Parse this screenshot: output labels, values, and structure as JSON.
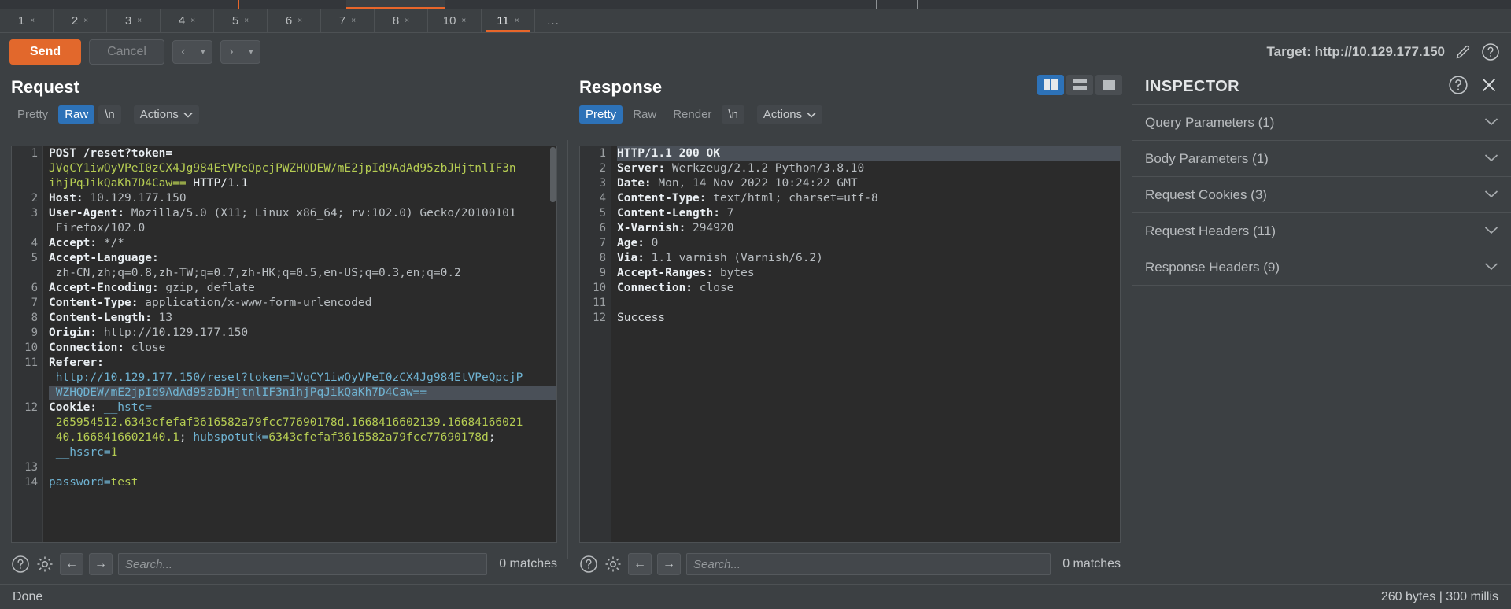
{
  "window": {
    "tabs": [
      {
        "label": "1",
        "close": "×",
        "active": false
      },
      {
        "label": "2",
        "close": "×",
        "active": false
      },
      {
        "label": "3",
        "close": "×",
        "active": false
      },
      {
        "label": "4",
        "close": "×",
        "active": false
      },
      {
        "label": "5",
        "close": "×",
        "active": false
      },
      {
        "label": "6",
        "close": "×",
        "active": false
      },
      {
        "label": "7",
        "close": "×",
        "active": false
      },
      {
        "label": "8",
        "close": "×",
        "active": false
      },
      {
        "label": "10",
        "close": "×",
        "active": false
      },
      {
        "label": "11",
        "close": "×",
        "active": true
      }
    ],
    "more_tabs_label": "..."
  },
  "actionbar": {
    "send_label": "Send",
    "cancel_label": "Cancel",
    "prev_icon": "‹",
    "prev_caret": "▾",
    "next_icon": "›",
    "next_caret": "▾",
    "target_label": "Target: http://10.129.177.150",
    "edit_icon": "pencil-icon",
    "help_icon": "help-circle-icon"
  },
  "request": {
    "title": "Request",
    "modes": [
      {
        "label": "Pretty",
        "style": "dim"
      },
      {
        "label": "Raw",
        "style": "selected"
      },
      {
        "label": "\\n",
        "style": "plain"
      },
      {
        "label": "Actions",
        "style": "group",
        "caret": "⌄"
      }
    ],
    "line_numbers": [
      "1",
      "",
      "",
      "2",
      "3",
      "",
      "4",
      "5",
      "",
      "6",
      "7",
      "8",
      "9",
      "10",
      "11",
      "",
      "",
      "12",
      "",
      "",
      "",
      "13",
      "14"
    ],
    "lines": [
      {
        "n": "1",
        "segments": [
          {
            "t": "POST /reset?token=",
            "c": "hdr"
          }
        ]
      },
      {
        "n": "",
        "segments": [
          {
            "t": "JVqCY1iwOyVPeI0zCX4Jg984EtVPeQpcjPWZHQDEW/mE2jpId9AdAd95zbJHjtnlIF3n",
            "c": "green"
          }
        ]
      },
      {
        "n": "",
        "segments": [
          {
            "t": "ihjPqJikQaKh7D4Caw==",
            "c": "green"
          },
          {
            "t": " HTTP/1.1",
            "c": "white"
          }
        ]
      },
      {
        "n": "2",
        "segments": [
          {
            "t": "Host:",
            "c": "hdr"
          },
          {
            "t": " 10.129.177.150",
            "c": "val"
          }
        ]
      },
      {
        "n": "3",
        "segments": [
          {
            "t": "User-Agent:",
            "c": "hdr"
          },
          {
            "t": " Mozilla/5.0 (X11; Linux x86_64; rv:102.0) Gecko/20100101",
            "c": "val"
          }
        ]
      },
      {
        "n": "",
        "segments": [
          {
            "t": " Firefox/102.0",
            "c": "val"
          }
        ]
      },
      {
        "n": "4",
        "segments": [
          {
            "t": "Accept:",
            "c": "hdr"
          },
          {
            "t": " */*",
            "c": "val"
          }
        ]
      },
      {
        "n": "5",
        "segments": [
          {
            "t": "Accept-Language:",
            "c": "hdr"
          }
        ]
      },
      {
        "n": "",
        "segments": [
          {
            "t": " zh-CN,zh;q=0.8,zh-TW;q=0.7,zh-HK;q=0.5,en-US;q=0.3,en;q=0.2",
            "c": "val"
          }
        ]
      },
      {
        "n": "6",
        "segments": [
          {
            "t": "Accept-Encoding:",
            "c": "hdr"
          },
          {
            "t": " gzip, deflate",
            "c": "val"
          }
        ]
      },
      {
        "n": "7",
        "segments": [
          {
            "t": "Content-Type:",
            "c": "hdr"
          },
          {
            "t": " application/x-www-form-urlencoded",
            "c": "val"
          }
        ]
      },
      {
        "n": "8",
        "segments": [
          {
            "t": "Content-Length:",
            "c": "hdr"
          },
          {
            "t": " 13",
            "c": "val"
          }
        ]
      },
      {
        "n": "9",
        "segments": [
          {
            "t": "Origin:",
            "c": "hdr"
          },
          {
            "t": " http://10.129.177.150",
            "c": "val"
          }
        ]
      },
      {
        "n": "10",
        "segments": [
          {
            "t": "Connection:",
            "c": "hdr"
          },
          {
            "t": " close",
            "c": "val"
          }
        ]
      },
      {
        "n": "11",
        "segments": [
          {
            "t": "Referer:",
            "c": "hdr"
          }
        ]
      },
      {
        "n": "",
        "segments": [
          {
            "t": " http://10.129.177.150/reset?token=JVqCY1iwOyVPeI0zCX4Jg984EtVPeQpcjP",
            "c": "blue"
          }
        ]
      },
      {
        "n": "",
        "selected": true,
        "segments": [
          {
            "t": " WZHQDEW/mE2jpId9AdAd95zbJHjtnlIF3nihjPqJikQaKh7D4Caw==",
            "c": "blue"
          }
        ]
      },
      {
        "n": "12",
        "segments": [
          {
            "t": "Cookie:",
            "c": "hdr"
          },
          {
            "t": " ",
            "c": "val"
          },
          {
            "t": "__hstc=",
            "c": "blue"
          }
        ]
      },
      {
        "n": "",
        "segments": [
          {
            "t": " 265954512.6343cfefaf3616582a79fcc77690178d.1668416602139.16684166021",
            "c": "green"
          }
        ]
      },
      {
        "n": "",
        "segments": [
          {
            "t": " 40.1668416602140.1",
            "c": "green"
          },
          {
            "t": "; ",
            "c": "plain"
          },
          {
            "t": "hubspotutk=",
            "c": "blue"
          },
          {
            "t": "6343cfefaf3616582a79fcc77690178d",
            "c": "green"
          },
          {
            "t": ";",
            "c": "plain"
          }
        ]
      },
      {
        "n": "",
        "segments": [
          {
            "t": " __hssrc=",
            "c": "blue"
          },
          {
            "t": "1",
            "c": "green"
          }
        ]
      },
      {
        "n": "13",
        "segments": []
      },
      {
        "n": "14",
        "segments": [
          {
            "t": "password=",
            "c": "blue"
          },
          {
            "t": "test",
            "c": "green"
          }
        ]
      }
    ],
    "search": {
      "placeholder": "Search...",
      "value": "",
      "matches": "0 matches",
      "help_icon": "help-circle-icon",
      "settings_icon": "gear-icon",
      "back_icon": "←",
      "forward_icon": "→"
    }
  },
  "response": {
    "title": "Response",
    "modes": [
      {
        "label": "Pretty",
        "style": "selected"
      },
      {
        "label": "Raw",
        "style": "dim"
      },
      {
        "label": "Render",
        "style": "dim"
      },
      {
        "label": "\\n",
        "style": "plain"
      },
      {
        "label": "Actions",
        "style": "group",
        "caret": "⌄"
      }
    ],
    "layout_buttons": [
      {
        "name": "split-vertical-layout",
        "active": true
      },
      {
        "name": "split-horizontal-layout",
        "active": false
      },
      {
        "name": "single-pane-layout",
        "active": false
      }
    ],
    "lines": [
      {
        "n": "1",
        "selected": true,
        "segments": [
          {
            "t": "HTTP/1.1 200 OK",
            "c": "hdr"
          }
        ]
      },
      {
        "n": "2",
        "segments": [
          {
            "t": "Server:",
            "c": "hdr"
          },
          {
            "t": " Werkzeug/2.1.2 Python/3.8.10",
            "c": "val"
          }
        ]
      },
      {
        "n": "3",
        "segments": [
          {
            "t": "Date:",
            "c": "hdr"
          },
          {
            "t": " Mon, 14 Nov 2022 10:24:22 GMT",
            "c": "val"
          }
        ]
      },
      {
        "n": "4",
        "segments": [
          {
            "t": "Content-Type:",
            "c": "hdr"
          },
          {
            "t": " text/html; charset=utf-8",
            "c": "val"
          }
        ]
      },
      {
        "n": "5",
        "segments": [
          {
            "t": "Content-Length:",
            "c": "hdr"
          },
          {
            "t": " 7",
            "c": "val"
          }
        ]
      },
      {
        "n": "6",
        "segments": [
          {
            "t": "X-Varnish:",
            "c": "hdr"
          },
          {
            "t": " 294920",
            "c": "val"
          }
        ]
      },
      {
        "n": "7",
        "segments": [
          {
            "t": "Age:",
            "c": "hdr"
          },
          {
            "t": " 0",
            "c": "val"
          }
        ]
      },
      {
        "n": "8",
        "segments": [
          {
            "t": "Via:",
            "c": "hdr"
          },
          {
            "t": " 1.1 varnish (Varnish/6.2)",
            "c": "val"
          }
        ]
      },
      {
        "n": "9",
        "segments": [
          {
            "t": "Accept-Ranges:",
            "c": "hdr"
          },
          {
            "t": " bytes",
            "c": "val"
          }
        ]
      },
      {
        "n": "10",
        "segments": [
          {
            "t": "Connection:",
            "c": "hdr"
          },
          {
            "t": " close",
            "c": "val"
          }
        ]
      },
      {
        "n": "11",
        "segments": []
      },
      {
        "n": "12",
        "marker": true,
        "segments": [
          {
            "t": "Success",
            "c": "plain"
          }
        ]
      }
    ],
    "search": {
      "placeholder": "Search...",
      "value": "",
      "matches": "0 matches",
      "help_icon": "help-circle-icon",
      "settings_icon": "gear-icon",
      "back_icon": "←",
      "forward_icon": "→"
    }
  },
  "inspector": {
    "title": "INSPECTOR",
    "help_icon": "help-circle-icon",
    "close_icon": "close-icon",
    "sections": [
      {
        "label": "Query Parameters (1)"
      },
      {
        "label": "Body Parameters (1)"
      },
      {
        "label": "Request Cookies (3)"
      },
      {
        "label": "Request Headers (11)"
      },
      {
        "label": "Response Headers (9)"
      }
    ]
  },
  "statusbar": {
    "left": "Done",
    "right": "260 bytes | 300 millis"
  },
  "colors": {
    "accent_orange": "#e2682c",
    "accent_blue": "#2d72b8",
    "bg": "#3c4043",
    "editor_bg": "#2b2b2b",
    "string_green": "#b5cc52",
    "key_blue": "#6fb3d2"
  }
}
